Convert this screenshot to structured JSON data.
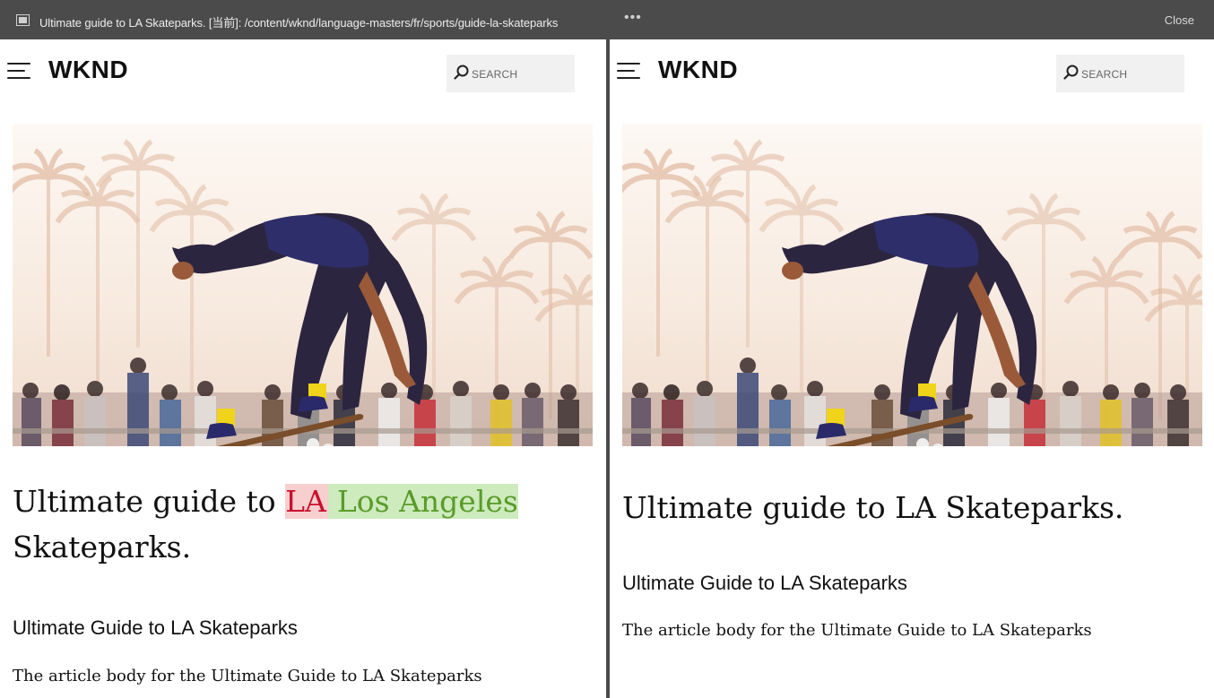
{
  "topbar": {
    "title": "Ultimate guide to LA Skateparks. [当前]: /content/wknd/language-masters/fr/sports/guide-la-skateparks",
    "more_label": "•••",
    "close_label": "Close"
  },
  "left": {
    "logo": "WKND",
    "search_placeholder": "SEARCH",
    "title_prefix": "Ultimate guide to ",
    "title_removed": "LA",
    "title_added": "Los Angeles",
    "title_suffix": " Skateparks.",
    "subtitle": "Ultimate Guide to LA Skateparks",
    "body": "The article body for the Ultimate Guide to LA Skateparks"
  },
  "right": {
    "logo": "WKND",
    "search_placeholder": "SEARCH",
    "title": "Ultimate guide to LA Skateparks.",
    "subtitle": "Ultimate Guide to LA Skateparks",
    "body": "The article body for the Ultimate Guide to LA Skateparks"
  },
  "colors": {
    "topbar": "#4b4b4b",
    "removed_bg": "#f8cfcf",
    "removed_text": "#c8102e",
    "added_bg": "#cdebbd",
    "added_text": "#5a9b2a"
  },
  "icons": [
    "frame-icon",
    "more-icon",
    "menu-icon",
    "search-icon"
  ]
}
